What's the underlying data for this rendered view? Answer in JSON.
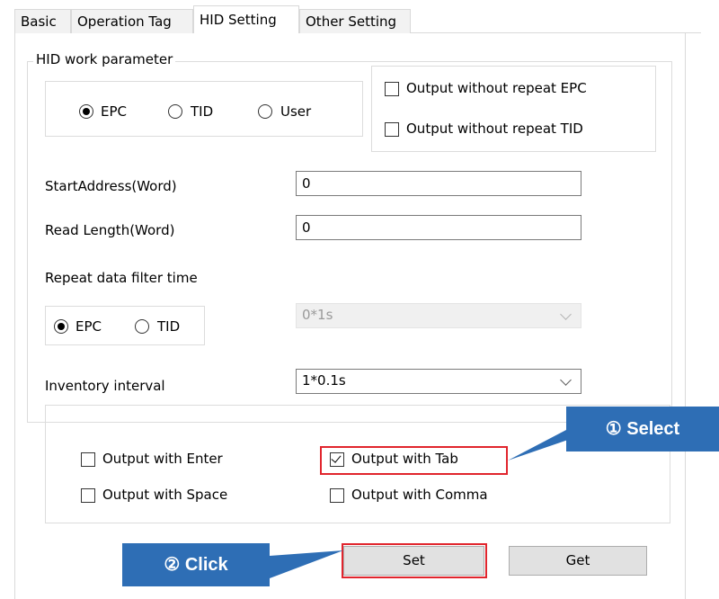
{
  "tabs": [
    {
      "label": "Basic"
    },
    {
      "label": "Operation Tag"
    },
    {
      "label": "HID Setting",
      "active": true
    },
    {
      "label": "Other Setting"
    }
  ],
  "hid_work_parameter": {
    "legend": "HID work parameter",
    "area_options": [
      "EPC",
      "TID",
      "User"
    ],
    "area_selected": "EPC",
    "output_without_repeat_epc": {
      "label": "Output without repeat EPC",
      "checked": false
    },
    "output_without_repeat_tid": {
      "label": "Output without repeat TID",
      "checked": false
    }
  },
  "start_address": {
    "label": "StartAddress(Word)",
    "value": "0"
  },
  "read_length": {
    "label": "Read Length(Word)",
    "value": "0"
  },
  "repeat_filter": {
    "label": "Repeat data filter time",
    "options": [
      "EPC",
      "TID"
    ],
    "selected": "EPC",
    "time_value": "0*1s",
    "time_disabled": true
  },
  "inventory_interval": {
    "label": "Inventory interval",
    "value": "1*0.1s"
  },
  "output_options": {
    "enter": {
      "label": "Output with Enter",
      "checked": false
    },
    "tab": {
      "label": "Output with Tab",
      "checked": true
    },
    "space": {
      "label": "Output with Space",
      "checked": false
    },
    "comma": {
      "label": "Output with Comma",
      "checked": false
    }
  },
  "buttons": {
    "set": "Set",
    "get": "Get"
  },
  "callouts": {
    "select": "① Select",
    "click": "② Click"
  },
  "colors": {
    "callout": "#2e6eb5",
    "highlight": "#e1252d"
  }
}
